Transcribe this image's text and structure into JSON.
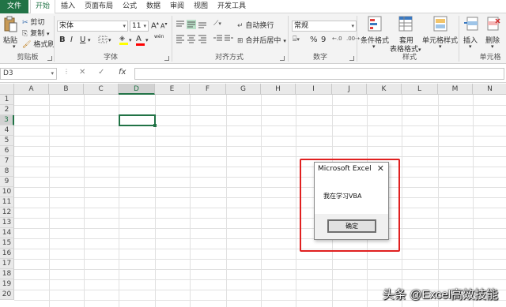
{
  "ribbon": {
    "tabs": [
      "文件",
      "开始",
      "插入",
      "页面布局",
      "公式",
      "数据",
      "审阅",
      "视图",
      "开发工具"
    ],
    "clipboard": {
      "paste_label": "粘贴",
      "cut_label": "剪切",
      "copy_label": "复制",
      "format_painter_label": "格式刷",
      "group_label": "剪贴板"
    },
    "font": {
      "name": "宋体",
      "size": "11",
      "bold": "B",
      "italic": "I",
      "underline": "U",
      "grow": "A",
      "shrink": "A",
      "font_color_glyph": "A",
      "wen_glyph": "wén",
      "group_label": "字体"
    },
    "alignment": {
      "wrap_text_label": "自动换行",
      "merge_center_label": "合并后居中",
      "group_label": "对齐方式"
    },
    "number": {
      "format": "常规",
      "percent": "%",
      "comma": "9",
      "group_label": "数字"
    },
    "styles": {
      "conditional_label": "条件格式",
      "table_label_line1": "套用",
      "table_label_line2": "表格格式",
      "cell_styles_label": "单元格样式",
      "group_label": "样式"
    },
    "cells": {
      "insert_label": "插入",
      "delete_label": "删除",
      "group_label": "单元格"
    }
  },
  "formula_bar": {
    "name_box": "D3",
    "cancel_glyph": "✕",
    "enter_glyph": "✓",
    "fx_glyph": "fx",
    "value": ""
  },
  "sheet": {
    "columns": [
      "A",
      "B",
      "C",
      "D",
      "E",
      "F",
      "G",
      "H",
      "I",
      "J",
      "K",
      "L",
      "M",
      "N"
    ],
    "rows": [
      "1",
      "2",
      "3",
      "4",
      "5",
      "6",
      "7",
      "8",
      "9",
      "10",
      "11",
      "12",
      "13",
      "14",
      "15",
      "16",
      "17",
      "18",
      "19",
      "20"
    ],
    "selected_cell": "D3"
  },
  "msgbox": {
    "title": "Microsoft Excel",
    "close_glyph": "✕",
    "message": "我在学习VBA",
    "ok_label": "确定"
  },
  "watermark": "头条 @Excel高效技能",
  "colors": {
    "accent": "#217346",
    "highlight": "#e02020"
  }
}
